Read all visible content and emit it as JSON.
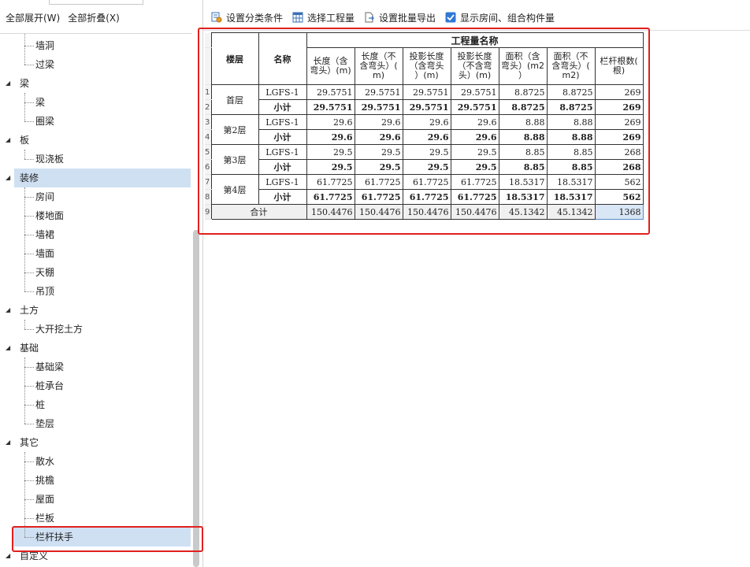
{
  "left_toolbar": {
    "expand_all": "全部展开(W)",
    "collapse_all": "全部折叠(X)"
  },
  "tree": [
    {
      "type": "child",
      "label": "墙洞"
    },
    {
      "type": "child",
      "label": "过梁"
    },
    {
      "type": "group",
      "label": "梁"
    },
    {
      "type": "child",
      "label": "梁"
    },
    {
      "type": "child",
      "label": "圈梁"
    },
    {
      "type": "group",
      "label": "板"
    },
    {
      "type": "child",
      "label": "现浇板"
    },
    {
      "type": "group",
      "label": "装修"
    },
    {
      "type": "child",
      "label": "房间"
    },
    {
      "type": "child",
      "label": "楼地面"
    },
    {
      "type": "child",
      "label": "墙裙"
    },
    {
      "type": "child",
      "label": "墙面"
    },
    {
      "type": "child",
      "label": "天棚"
    },
    {
      "type": "child",
      "label": "吊顶"
    },
    {
      "type": "group",
      "label": "土方"
    },
    {
      "type": "child",
      "label": "大开挖土方"
    },
    {
      "type": "group",
      "label": "基础"
    },
    {
      "type": "child",
      "label": "基础梁"
    },
    {
      "type": "child",
      "label": "桩承台"
    },
    {
      "type": "child",
      "label": "桩"
    },
    {
      "type": "child",
      "label": "垫层"
    },
    {
      "type": "group",
      "label": "其它"
    },
    {
      "type": "child",
      "label": "散水"
    },
    {
      "type": "child",
      "label": "挑檐"
    },
    {
      "type": "child",
      "label": "屋面"
    },
    {
      "type": "child",
      "label": "栏板"
    },
    {
      "type": "child",
      "label": "栏杆扶手"
    },
    {
      "type": "group",
      "label": "自定义"
    }
  ],
  "right_toolbar": {
    "set_category": "设置分类条件",
    "select_quantity": "选择工程量",
    "set_batch_export": "设置批量导出",
    "show_rooms": "显示房间、组合构件量",
    "show_rooms_checked": true
  },
  "table": {
    "group_header": "工程量名称",
    "col_floor": "楼层",
    "col_name": "名称",
    "quantity_cols": [
      [
        "长度（含",
        "弯头）(m)"
      ],
      [
        "长度（不",
        "含弯头）(",
        "m)"
      ],
      [
        "投影长度",
        "（含弯头",
        "）(m)"
      ],
      [
        "投影长度",
        "（不含弯",
        "头）(m)"
      ],
      [
        "面积（含",
        "弯头）(m2",
        "）"
      ],
      [
        "面积（不",
        "含弯头）(",
        "m2)"
      ],
      [
        "栏杆根数(",
        "根)"
      ]
    ],
    "row_numbers": [
      "1",
      "2",
      "3",
      "4",
      "5",
      "6",
      "7",
      "8",
      "9"
    ],
    "floors": [
      {
        "floor": "首层",
        "name": "LGFS-1",
        "values": [
          "29.5751",
          "29.5751",
          "29.5751",
          "29.5751",
          "8.8725",
          "8.8725",
          "269"
        ],
        "subtotal_label": "小计",
        "subtotal": [
          "29.5751",
          "29.5751",
          "29.5751",
          "29.5751",
          "8.8725",
          "8.8725",
          "269"
        ]
      },
      {
        "floor": "第2层",
        "name": "LGFS-1",
        "values": [
          "29.6",
          "29.6",
          "29.6",
          "29.6",
          "8.88",
          "8.88",
          "269"
        ],
        "subtotal_label": "小计",
        "subtotal": [
          "29.6",
          "29.6",
          "29.6",
          "29.6",
          "8.88",
          "8.88",
          "269"
        ]
      },
      {
        "floor": "第3层",
        "name": "LGFS-1",
        "values": [
          "29.5",
          "29.5",
          "29.5",
          "29.5",
          "8.85",
          "8.85",
          "268"
        ],
        "subtotal_label": "小计",
        "subtotal": [
          "29.5",
          "29.5",
          "29.5",
          "29.5",
          "8.85",
          "8.85",
          "268"
        ]
      },
      {
        "floor": "第4层",
        "name": "LGFS-1",
        "values": [
          "61.7725",
          "61.7725",
          "61.7725",
          "61.7725",
          "18.5317",
          "18.5317",
          "562"
        ],
        "subtotal_label": "小计",
        "subtotal": [
          "61.7725",
          "61.7725",
          "61.7725",
          "61.7725",
          "18.5317",
          "18.5317",
          "562"
        ]
      }
    ],
    "total_label": "合计",
    "total": [
      "150.4476",
      "150.4476",
      "150.4476",
      "150.4476",
      "45.1342",
      "45.1342",
      "1368"
    ]
  },
  "colors": {
    "highlight_red": "#e0201e",
    "selection_blue": "#cfe0f3",
    "checkbox_blue": "#2f78d6"
  }
}
